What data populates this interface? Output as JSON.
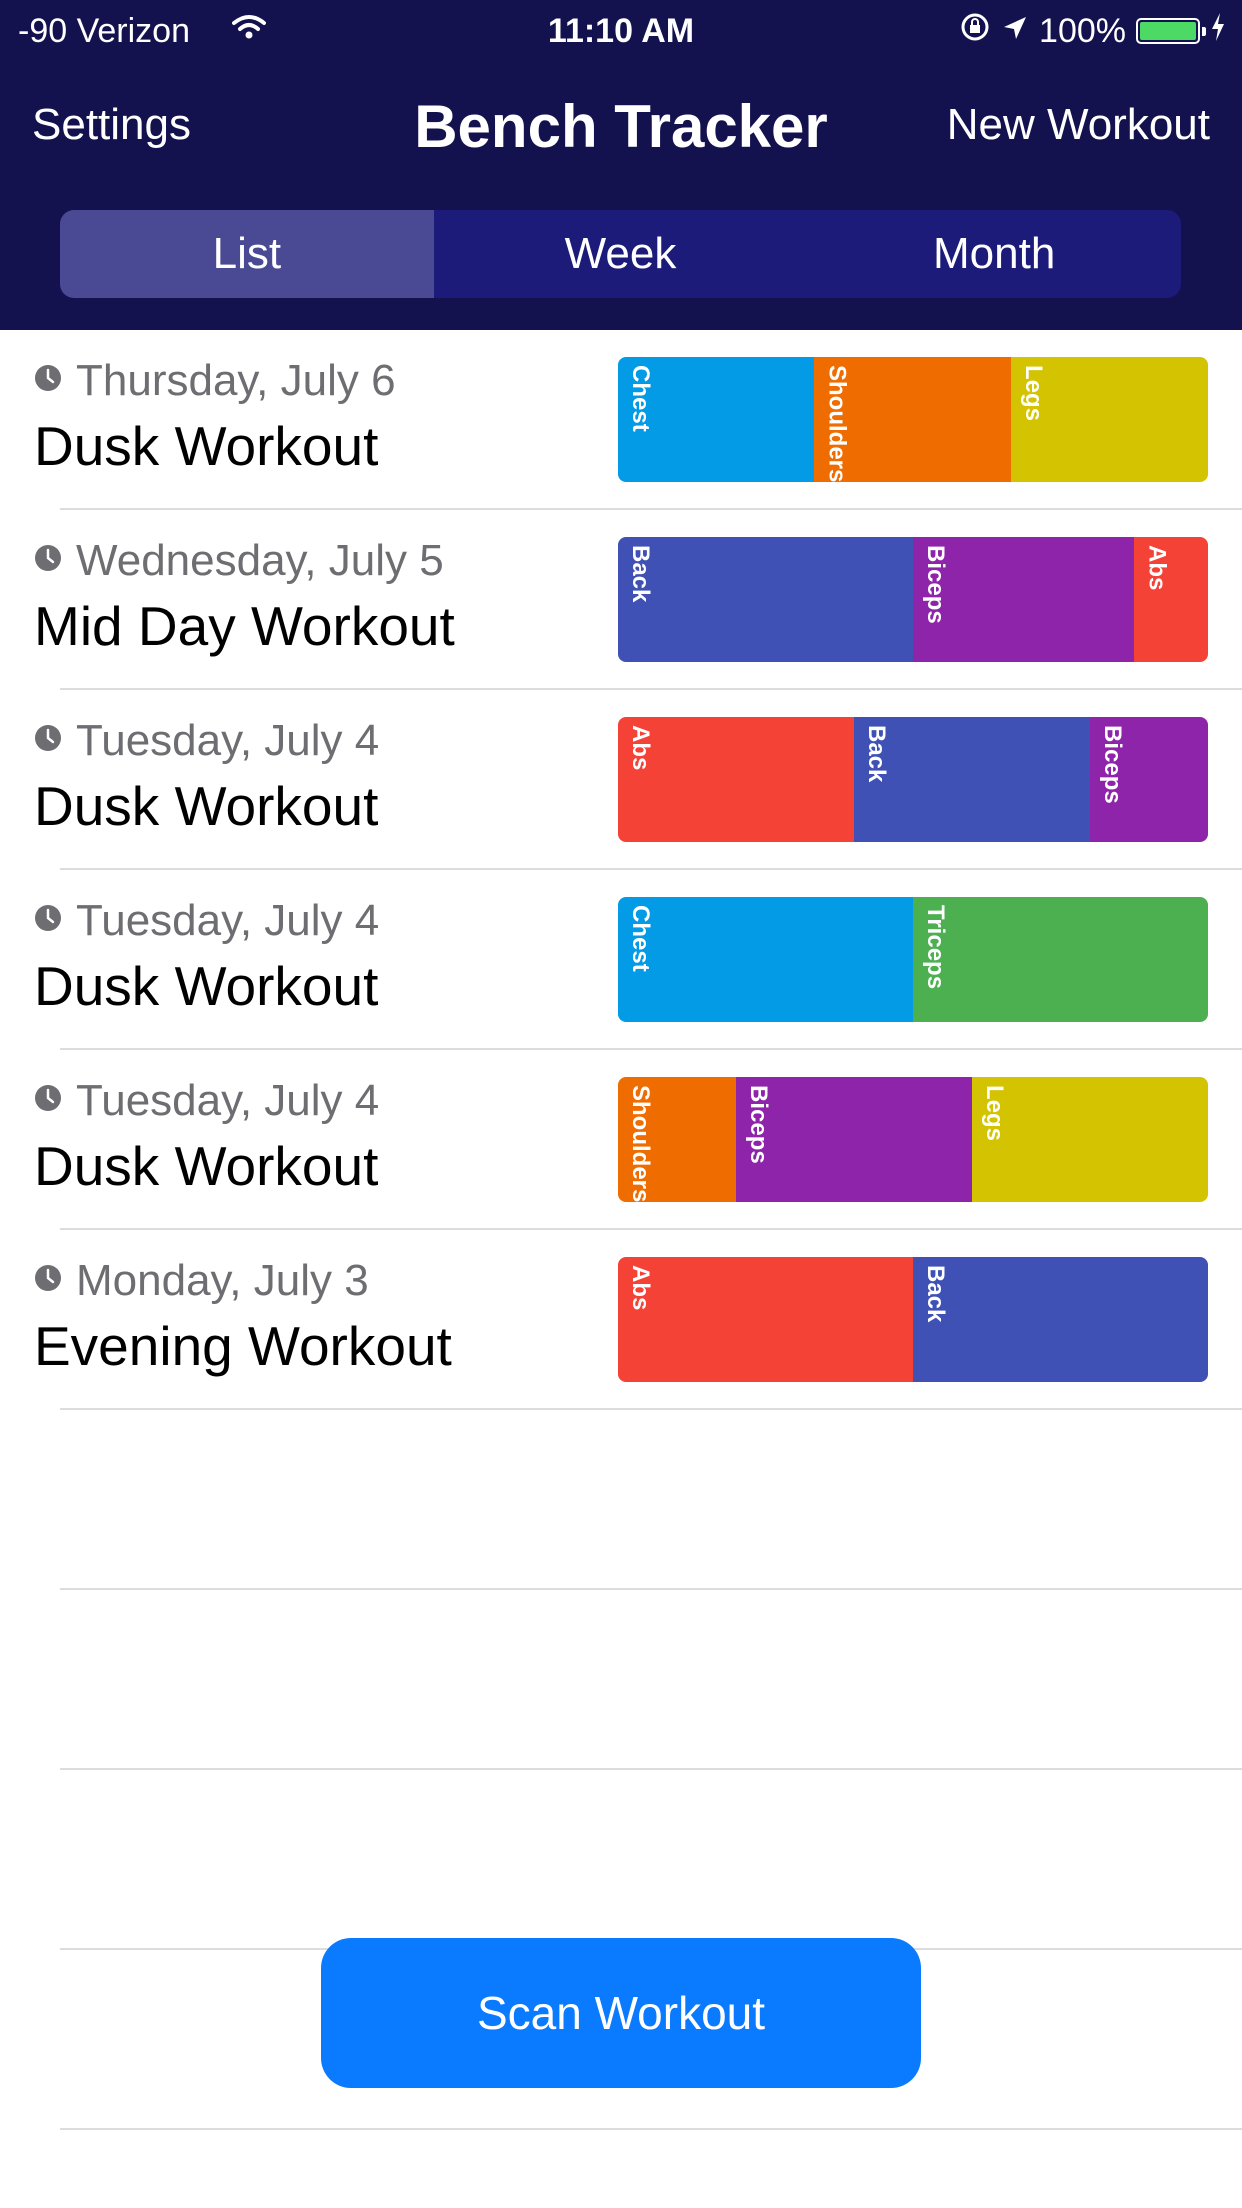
{
  "status_bar": {
    "carrier": "-90 Verizon",
    "time": "11:10 AM",
    "battery": "100%"
  },
  "nav": {
    "left": "Settings",
    "title": "Bench Tracker",
    "right": "New Workout"
  },
  "segments": [
    "List",
    "Week",
    "Month"
  ],
  "selected_segment": "List",
  "colors": {
    "header": "#13124f",
    "Chest": "#039be5",
    "Shoulders": "#ef6c00",
    "Legs": "#d4c300",
    "Back": "#3f51b5",
    "Biceps": "#8e24aa",
    "Abs": "#f44336",
    "Triceps": "#4caf50",
    "button": "#0a7aff"
  },
  "workouts": [
    {
      "date": "Thursday, July 6",
      "title": "Dusk Workout",
      "muscles": [
        {
          "name": "Chest",
          "fraction": 0.333
        },
        {
          "name": "Shoulders",
          "fraction": 0.333
        },
        {
          "name": "Legs",
          "fraction": 0.334
        }
      ]
    },
    {
      "date": "Wednesday, July 5",
      "title": "Mid Day Workout",
      "muscles": [
        {
          "name": "Back",
          "fraction": 0.5
        },
        {
          "name": "Biceps",
          "fraction": 0.375
        },
        {
          "name": "Abs",
          "fraction": 0.125
        }
      ]
    },
    {
      "date": "Tuesday, July 4",
      "title": "Dusk Workout",
      "muscles": [
        {
          "name": "Abs",
          "fraction": 0.4
        },
        {
          "name": "Back",
          "fraction": 0.4
        },
        {
          "name": "Biceps",
          "fraction": 0.2
        }
      ]
    },
    {
      "date": "Tuesday, July 4",
      "title": "Dusk Workout",
      "muscles": [
        {
          "name": "Chest",
          "fraction": 0.5
        },
        {
          "name": "Triceps",
          "fraction": 0.5
        }
      ]
    },
    {
      "date": "Tuesday, July 4",
      "title": "Dusk Workout",
      "muscles": [
        {
          "name": "Shoulders",
          "fraction": 0.2
        },
        {
          "name": "Biceps",
          "fraction": 0.4
        },
        {
          "name": "Legs",
          "fraction": 0.4
        }
      ]
    },
    {
      "date": "Monday, July 3",
      "title": "Evening Workout",
      "muscles": [
        {
          "name": "Abs",
          "fraction": 0.5
        },
        {
          "name": "Back",
          "fraction": 0.5
        }
      ]
    }
  ],
  "empty_rows": 4,
  "scan_button": "Scan Workout"
}
